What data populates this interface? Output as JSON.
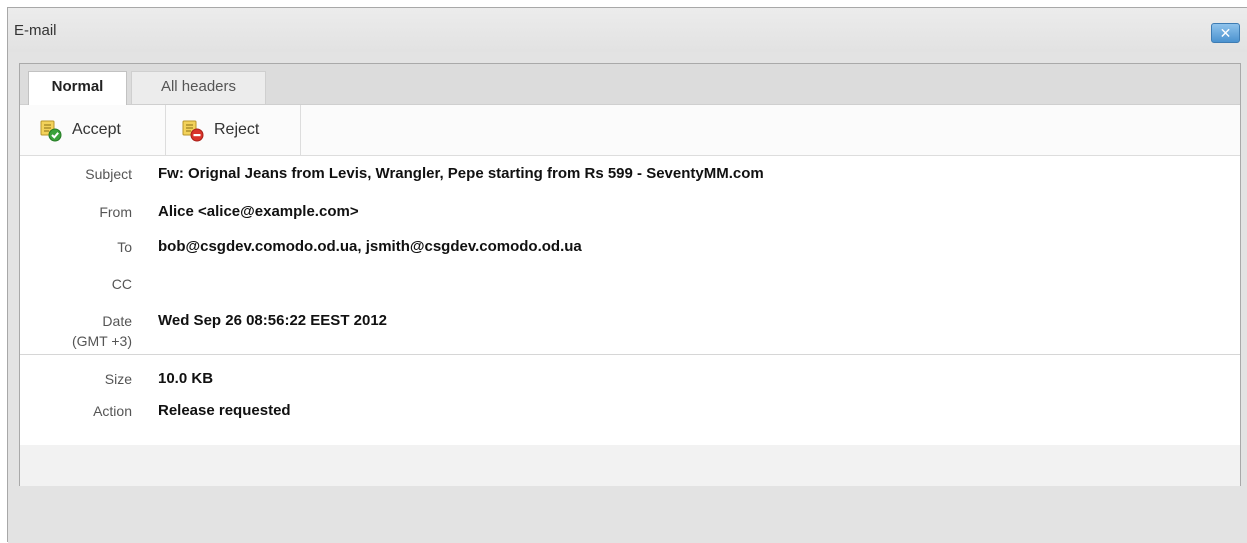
{
  "window": {
    "title": "E-mail",
    "close_label": "✕"
  },
  "tabs": [
    {
      "label": "Normal",
      "active": true
    },
    {
      "label": "All headers",
      "active": false
    }
  ],
  "toolbar": {
    "accept_label": "Accept",
    "reject_label": "Reject"
  },
  "fields": {
    "subject": {
      "label": "Subject",
      "value": "Fw: Orignal Jeans from Levis, Wrangler, Pepe starting from Rs 599 - SeventyMM.com"
    },
    "from": {
      "label": "From",
      "value": "Alice <alice@example.com>"
    },
    "to": {
      "label": "To",
      "value": "bob@csgdev.comodo.od.ua, jsmith@csgdev.comodo.od.ua"
    },
    "cc": {
      "label": "CC",
      "value": ""
    },
    "date": {
      "label": "Date",
      "sublabel": "(GMT +3)",
      "value": "Wed Sep 26 08:56:22 EEST 2012"
    },
    "size": {
      "label": "Size",
      "value": "10.0 KB"
    },
    "action": {
      "label": "Action",
      "value": "Release requested"
    }
  },
  "colors": {
    "close_button": "#4b92cf",
    "accept_badge": "#3aa23a",
    "reject_badge": "#d9342b"
  },
  "icons": {
    "accept": "accept-icon",
    "reject": "reject-icon",
    "close": "close-icon"
  }
}
